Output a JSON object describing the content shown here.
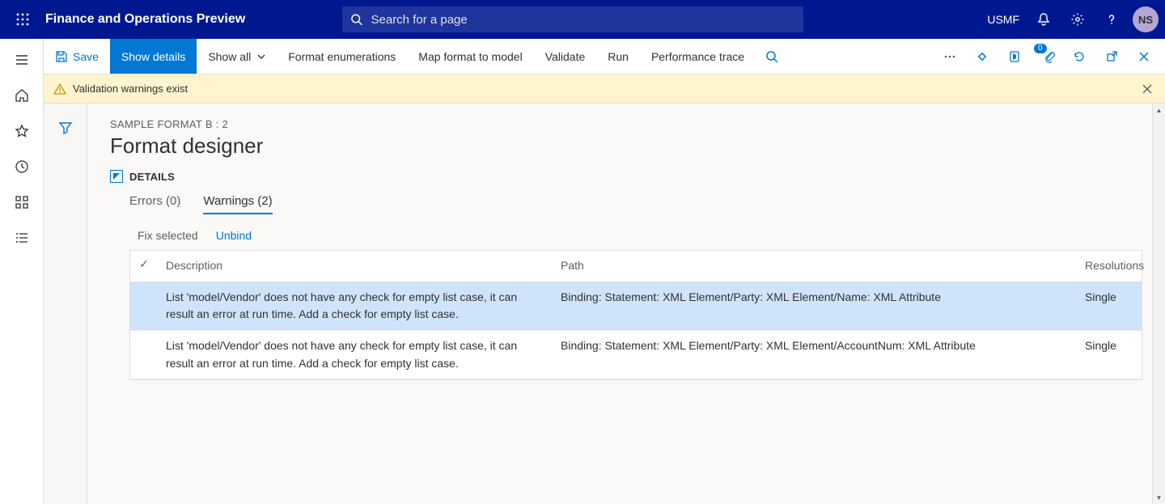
{
  "header": {
    "app_title": "Finance and Operations Preview",
    "search_placeholder": "Search for a page",
    "company": "USMF",
    "avatar_initials": "NS"
  },
  "action_bar": {
    "save": "Save",
    "show_details": "Show details",
    "show_all": "Show all",
    "format_enumerations": "Format enumerations",
    "map_format_to_model": "Map format to model",
    "validate": "Validate",
    "run": "Run",
    "performance_trace": "Performance trace",
    "attachment_badge": "0"
  },
  "banner": {
    "text": "Validation warnings exist"
  },
  "page": {
    "breadcrumb": "SAMPLE FORMAT B : 2",
    "title": "Format designer",
    "details_label": "DETAILS",
    "tabs": {
      "errors": "Errors (0)",
      "warnings": "Warnings (2)"
    },
    "subactions": {
      "fix_selected": "Fix selected",
      "unbind": "Unbind"
    },
    "columns": {
      "description": "Description",
      "path": "Path",
      "resolutions": "Resolutions"
    },
    "rows": [
      {
        "description": "List 'model/Vendor' does not have any check for empty list case, it can result an error at run time. Add a check for empty list case.",
        "path": "Binding: Statement: XML Element/Party: XML Element/Name: XML Attribute",
        "resolutions": "Single"
      },
      {
        "description": "List 'model/Vendor' does not have any check for empty list case, it can result an error at run time. Add a check for empty list case.",
        "path": "Binding: Statement: XML Element/Party: XML Element/AccountNum: XML Attribute",
        "resolutions": "Single"
      }
    ]
  }
}
